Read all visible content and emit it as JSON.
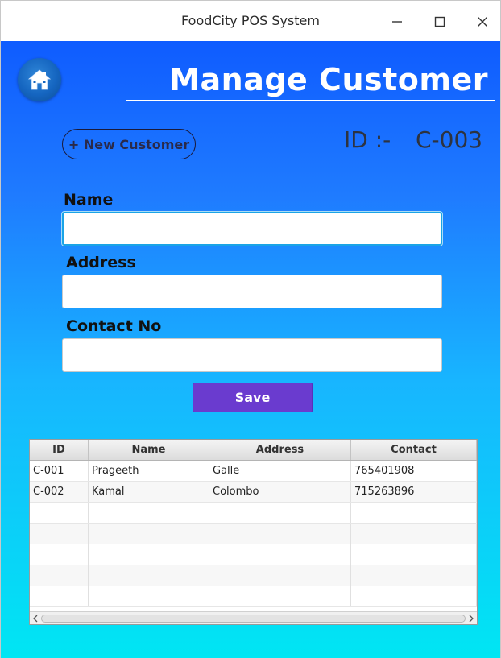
{
  "window": {
    "title": "FoodCity POS System"
  },
  "header": {
    "title": "Manage Customer",
    "home_icon": "home-icon"
  },
  "toolbar": {
    "new_customer_label": "+ New Customer"
  },
  "id_display": {
    "label": "ID  :-",
    "value": "C-003"
  },
  "form": {
    "name_label": "Name",
    "name_value": "",
    "address_label": "Address",
    "address_value": "",
    "contact_label": "Contact No",
    "contact_value": "",
    "save_label": "Save"
  },
  "table": {
    "headers": [
      "ID",
      "Name",
      "Address",
      "Contact"
    ],
    "rows": [
      [
        "C-001",
        "Prageeth",
        "Galle",
        "765401908"
      ],
      [
        "C-002",
        "Kamal",
        "Colombo",
        "715263896"
      ]
    ],
    "empty_rows": 6
  },
  "colors": {
    "gradient_top": "#0f5cff",
    "gradient_bottom": "#00e6f3",
    "save_button": "#6a3bcf",
    "focus_border": "#1aa4e6"
  }
}
